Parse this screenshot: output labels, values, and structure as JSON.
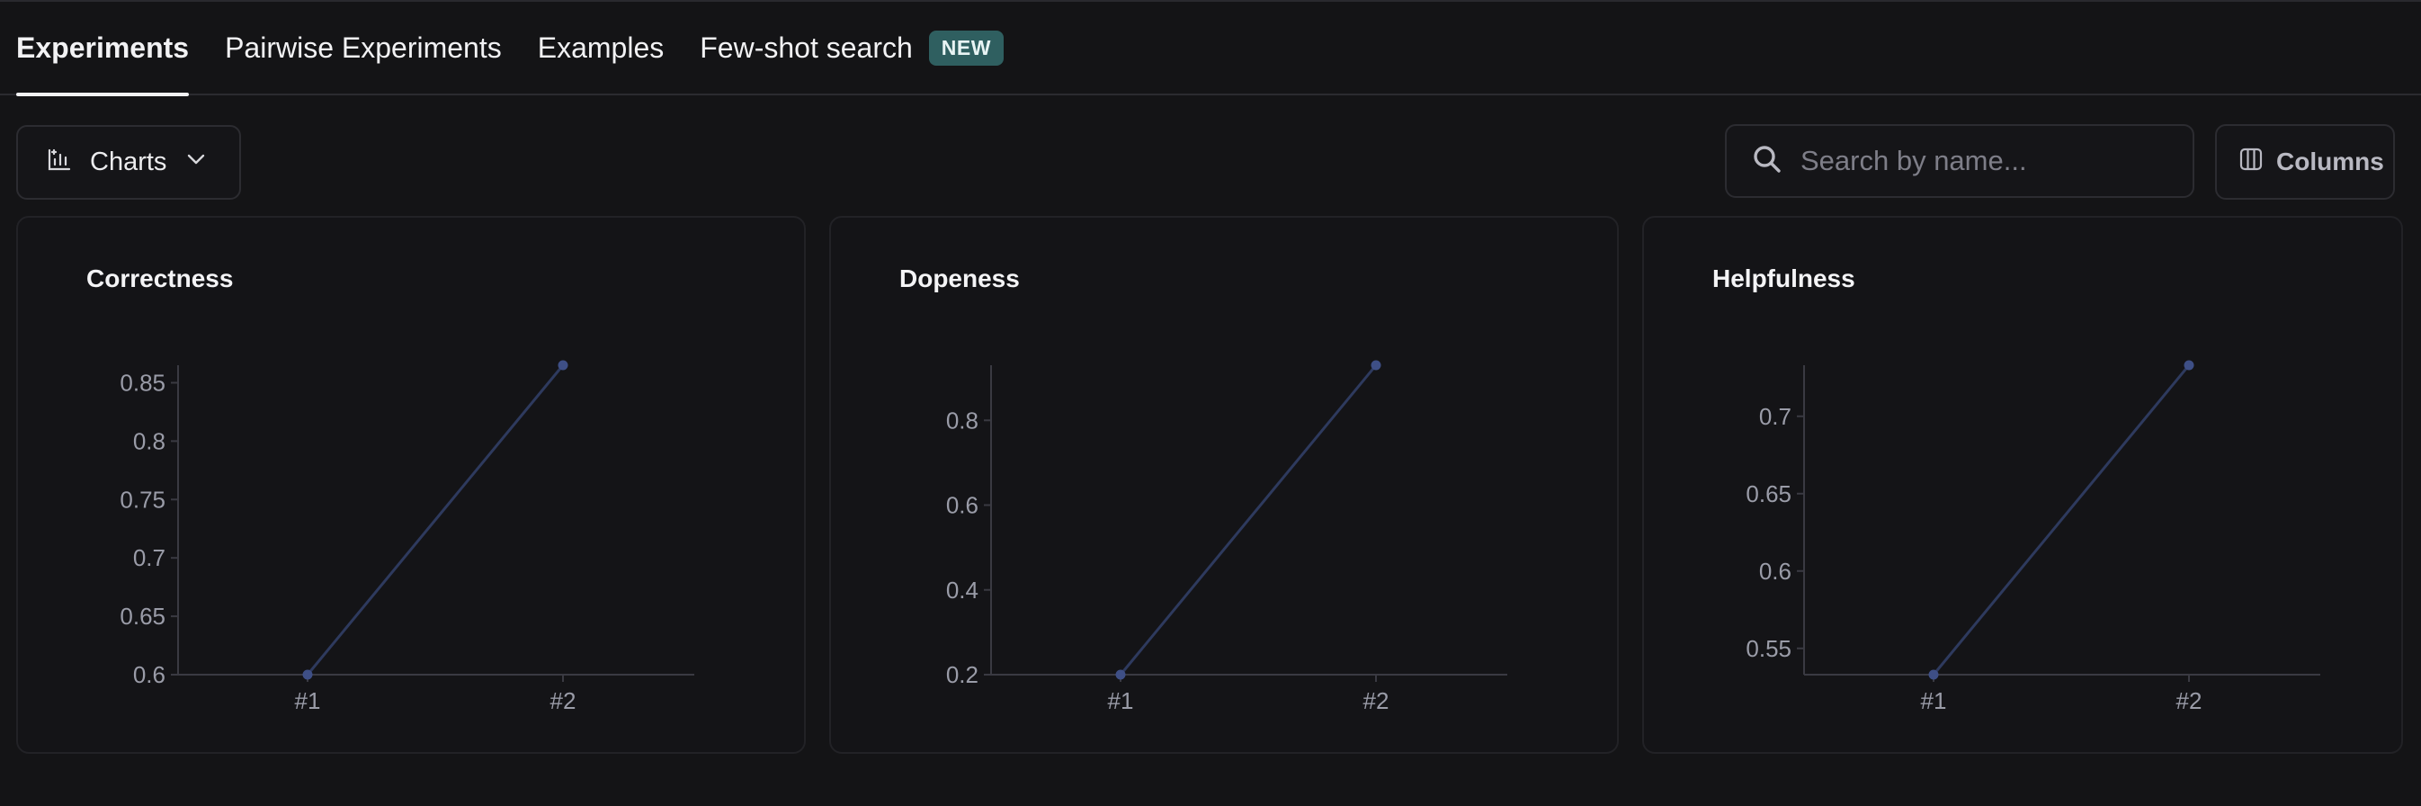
{
  "tabs": [
    {
      "label": "Experiments",
      "active": true
    },
    {
      "label": "Pairwise Experiments",
      "active": false
    },
    {
      "label": "Examples",
      "active": false
    },
    {
      "label": "Few-shot search",
      "active": false,
      "badge": "NEW"
    }
  ],
  "toolbar": {
    "charts_label": "Charts",
    "charts_icon": "chart-icon",
    "search_placeholder": "Search by name...",
    "search_value": "",
    "columns_label": "Columns"
  },
  "colors": {
    "background": "#141416",
    "line": "#2e3a5e",
    "point": "#3e4f86",
    "badge": "#2f5f60"
  },
  "chart_data": [
    {
      "type": "line",
      "title": "Correctness",
      "categories": [
        "#1",
        "#2"
      ],
      "values": [
        0.6,
        0.865
      ],
      "yticks": [
        "0.6",
        "0.65",
        "0.7",
        "0.75",
        "0.8",
        "0.85"
      ],
      "ylim": [
        0.6,
        0.865
      ]
    },
    {
      "type": "line",
      "title": "Dopeness",
      "categories": [
        "#1",
        "#2"
      ],
      "values": [
        0.2,
        0.93
      ],
      "yticks": [
        "0.2",
        "0.4",
        "0.6",
        "0.8"
      ],
      "ylim": [
        0.2,
        0.93
      ]
    },
    {
      "type": "line",
      "title": "Helpfulness",
      "categories": [
        "#1",
        "#2"
      ],
      "values": [
        0.533,
        0.733
      ],
      "yticks": [
        "0.55",
        "0.6",
        "0.65",
        "0.7"
      ],
      "ylim": [
        0.533,
        0.733
      ]
    }
  ]
}
